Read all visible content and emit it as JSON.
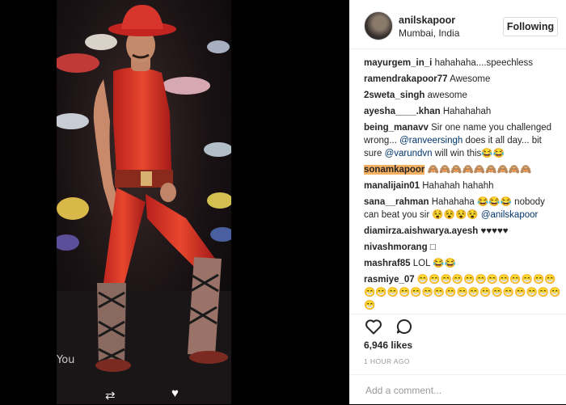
{
  "post": {
    "overlay_text": "You",
    "repost_glyph": "⇄",
    "heart_glyph": "♥"
  },
  "header": {
    "username": "anilskapoor",
    "location": "Mumbai, India",
    "follow_label": "Following"
  },
  "comments": [
    {
      "user": "mayurgem_in_i",
      "parts": [
        {
          "t": "hahahaha....speechless"
        }
      ]
    },
    {
      "user": "ramendrakapoor77",
      "parts": [
        {
          "t": "Awesome"
        }
      ]
    },
    {
      "user": "2sweta_singh",
      "parts": [
        {
          "t": "awesome"
        }
      ]
    },
    {
      "user": "ayesha____.khan",
      "parts": [
        {
          "t": "Hahahahah"
        }
      ]
    },
    {
      "user": "being_manavv",
      "parts": [
        {
          "t": "Sir one name you challenged wrong... "
        },
        {
          "t": "@ranveersingh",
          "m": true
        },
        {
          "t": " does it all day... bit sure "
        },
        {
          "t": "@varundvn",
          "m": true
        },
        {
          "t": " will win this😂😂"
        }
      ]
    },
    {
      "user": "sonamkapoor",
      "highlight": true,
      "parts": [
        {
          "t": "🙈🙈🙈🙈🙈🙈🙈🙈🙈"
        }
      ]
    },
    {
      "user": "manalijain01",
      "parts": [
        {
          "t": "Hahahah hahahh"
        }
      ]
    },
    {
      "user": "sana__rahman",
      "parts": [
        {
          "t": "Hahahaha 😂😂😂 nobody can beat you sir 😵😵😵😵 "
        },
        {
          "t": "@anilskapoor",
          "m": true
        }
      ]
    },
    {
      "user": "diamirza.aishwarya.ayesh",
      "parts": [
        {
          "t": "♥♥♥♥♥"
        }
      ]
    },
    {
      "user": "nivashmorang",
      "parts": [
        {
          "t": "□"
        }
      ]
    },
    {
      "user": "mashraf85",
      "parts": [
        {
          "t": "LOL 😂😂"
        }
      ]
    },
    {
      "user": "rasmiye_07",
      "parts": [
        {
          "t": "😁😁😁😁😁😁😁😁😁😁😁😁😁😁😁😁😁😁😁😁😁😁😁😁😁😁😁😁😁😁"
        }
      ]
    }
  ],
  "actions": {
    "like_icon": "heart-outline-icon",
    "comment_icon": "speech-bubble-icon"
  },
  "likes_text": "6,946 likes",
  "time_text": "1 HOUR AGO",
  "comment_box": {
    "placeholder": "Add a comment...",
    "value": ""
  }
}
